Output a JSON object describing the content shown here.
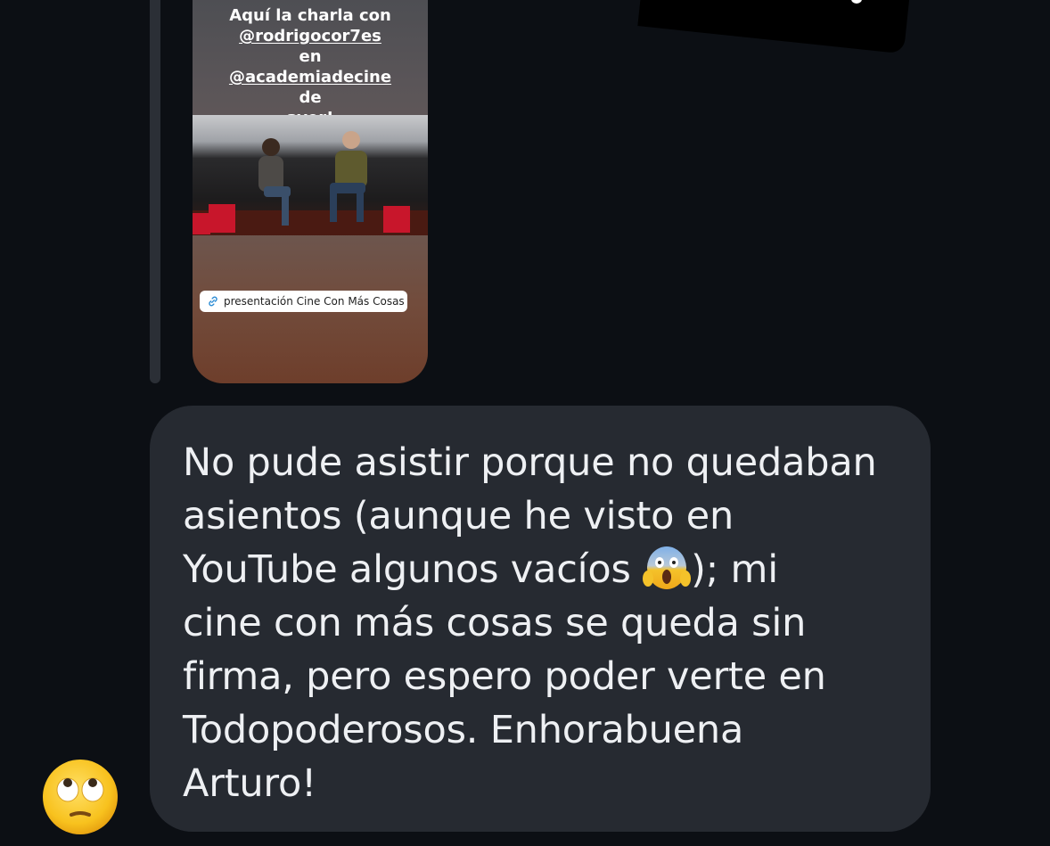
{
  "story": {
    "caption_line1": "Aquí la charla con",
    "caption_mention1": "@rodrigocor7es",
    "caption_mid": " en",
    "caption_mention2": "@academiadecine",
    "caption_tail": " de",
    "caption_line4": "ayer!",
    "link_label": "presentación Cine Con Más Cosas"
  },
  "message": {
    "text_part1": "No pude asistir porque no quedaban\nasientos (aunque he visto en\nYouTube algunos vacíos ",
    "emoji_name": "face-screaming-in-fear",
    "text_part2": "); mi\ncine con más cosas se queda sin\nfirma, pero espero poder verte en\nTodopoderosos. Enhorabuena\nArturo!"
  },
  "reaction": {
    "emoji_name": "face-with-rolling-eyes"
  },
  "colors": {
    "background": "#0c0f14",
    "bubble": "#262a31",
    "text": "#eef0f3",
    "link_chip": "#ffffff"
  }
}
